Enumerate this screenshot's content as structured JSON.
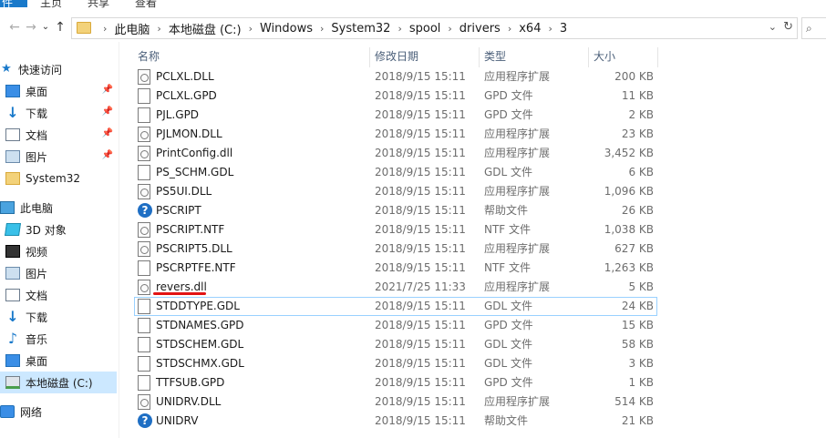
{
  "ribbon": {
    "tabs": [
      "件",
      "主页",
      "共享",
      "查看"
    ]
  },
  "address": {
    "crumbs": [
      "此电脑",
      "本地磁盘 (C:)",
      "Windows",
      "System32",
      "spool",
      "drivers",
      "x64",
      "3"
    ]
  },
  "sidebar": {
    "items": [
      {
        "label": "快速访问",
        "icon": "star-icon",
        "pinned": false
      },
      {
        "label": "桌面",
        "icon": "desktop-icon",
        "pinned": true
      },
      {
        "label": "下载",
        "icon": "download-icon",
        "pinned": true
      },
      {
        "label": "文档",
        "icon": "document-icon",
        "pinned": true
      },
      {
        "label": "图片",
        "icon": "picture-icon",
        "pinned": true
      },
      {
        "label": "System32",
        "icon": "folder-icon",
        "pinned": false
      },
      {
        "label": "此电脑",
        "icon": "computer-icon",
        "pinned": false
      },
      {
        "label": "3D 对象",
        "icon": "3d-objects-icon",
        "pinned": false
      },
      {
        "label": "视频",
        "icon": "video-icon",
        "pinned": false
      },
      {
        "label": "图片",
        "icon": "picture-icon",
        "pinned": false
      },
      {
        "label": "文档",
        "icon": "document-icon",
        "pinned": false
      },
      {
        "label": "下载",
        "icon": "download-icon",
        "pinned": false
      },
      {
        "label": "音乐",
        "icon": "music-icon",
        "pinned": false
      },
      {
        "label": "桌面",
        "icon": "desktop-icon",
        "pinned": false
      },
      {
        "label": "本地磁盘 (C:)",
        "icon": "drive-icon",
        "pinned": false,
        "selected": true
      },
      {
        "label": "网络",
        "icon": "network-icon",
        "pinned": false
      }
    ]
  },
  "columns": {
    "name": "名称",
    "modified": "修改日期",
    "type": "类型",
    "size": "大小"
  },
  "files": [
    {
      "name": "PCLXL.DLL",
      "modified": "2018/9/15 15:11",
      "type": "应用程序扩展",
      "size": "200 KB",
      "icon": "dll"
    },
    {
      "name": "PCLXL.GPD",
      "modified": "2018/9/15 15:11",
      "type": "GPD 文件",
      "size": "11 KB",
      "icon": "gen"
    },
    {
      "name": "PJL.GPD",
      "modified": "2018/9/15 15:11",
      "type": "GPD 文件",
      "size": "2 KB",
      "icon": "gen"
    },
    {
      "name": "PJLMON.DLL",
      "modified": "2018/9/15 15:11",
      "type": "应用程序扩展",
      "size": "23 KB",
      "icon": "dll"
    },
    {
      "name": "PrintConfig.dll",
      "modified": "2018/9/15 15:11",
      "type": "应用程序扩展",
      "size": "3,452 KB",
      "icon": "dll"
    },
    {
      "name": "PS_SCHM.GDL",
      "modified": "2018/9/15 15:11",
      "type": "GDL 文件",
      "size": "6 KB",
      "icon": "gen"
    },
    {
      "name": "PS5UI.DLL",
      "modified": "2018/9/15 15:11",
      "type": "应用程序扩展",
      "size": "1,096 KB",
      "icon": "dll"
    },
    {
      "name": "PSCRIPT",
      "modified": "2018/9/15 15:11",
      "type": "帮助文件",
      "size": "26 KB",
      "icon": "help"
    },
    {
      "name": "PSCRIPT.NTF",
      "modified": "2018/9/15 15:11",
      "type": "NTF 文件",
      "size": "1,038 KB",
      "icon": "dll"
    },
    {
      "name": "PSCRIPT5.DLL",
      "modified": "2018/9/15 15:11",
      "type": "应用程序扩展",
      "size": "627 KB",
      "icon": "dll"
    },
    {
      "name": "PSCRPTFE.NTF",
      "modified": "2018/9/15 15:11",
      "type": "NTF 文件",
      "size": "1,263 KB",
      "icon": "gen"
    },
    {
      "name": "revers.dll",
      "modified": "2021/7/25 11:33",
      "type": "应用程序扩展",
      "size": "5 KB",
      "icon": "dll"
    },
    {
      "name": "STDDTYPE.GDL",
      "modified": "2018/9/15 15:11",
      "type": "GDL 文件",
      "size": "24 KB",
      "icon": "gen",
      "focused": true
    },
    {
      "name": "STDNAMES.GPD",
      "modified": "2018/9/15 15:11",
      "type": "GPD 文件",
      "size": "15 KB",
      "icon": "gen"
    },
    {
      "name": "STDSCHEM.GDL",
      "modified": "2018/9/15 15:11",
      "type": "GDL 文件",
      "size": "58 KB",
      "icon": "gen"
    },
    {
      "name": "STDSCHMX.GDL",
      "modified": "2018/9/15 15:11",
      "type": "GDL 文件",
      "size": "3 KB",
      "icon": "gen"
    },
    {
      "name": "TTFSUB.GPD",
      "modified": "2018/9/15 15:11",
      "type": "GPD 文件",
      "size": "1 KB",
      "icon": "gen"
    },
    {
      "name": "UNIDRV.DLL",
      "modified": "2018/9/15 15:11",
      "type": "应用程序扩展",
      "size": "514 KB",
      "icon": "dll"
    },
    {
      "name": "UNIDRV",
      "modified": "2018/9/15 15:11",
      "type": "帮助文件",
      "size": "21 KB",
      "icon": "help"
    }
  ]
}
